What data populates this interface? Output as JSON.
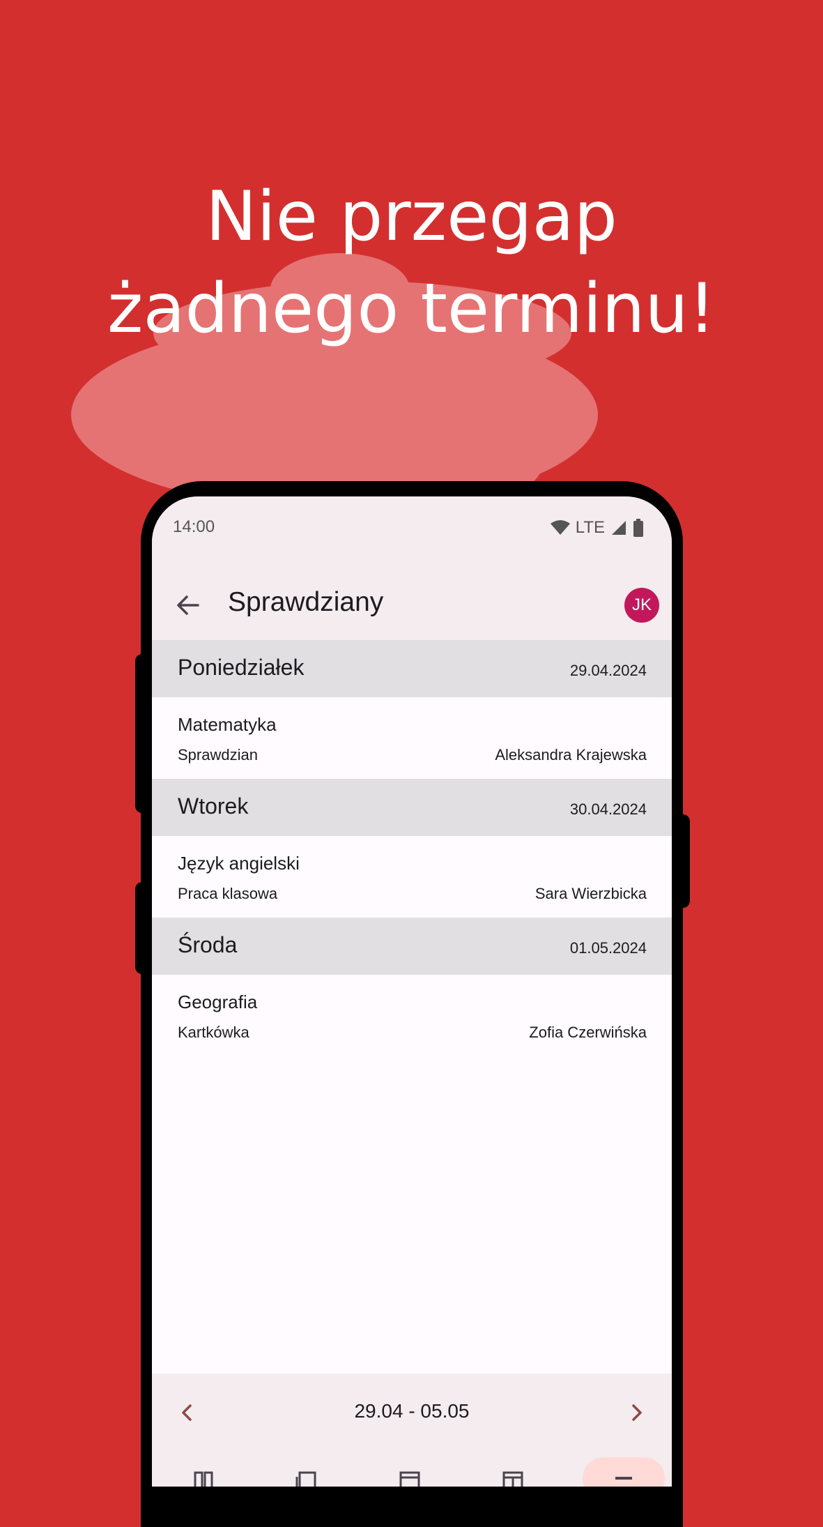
{
  "headline": {
    "line1": "Nie przegap",
    "line2": "żadnego terminu!"
  },
  "colors": {
    "background": "#d32f2f",
    "cloud": "#e57373",
    "surface": "#fffbfe",
    "app_bar": "#f4ecee",
    "day_header": "#e1dfe2",
    "avatar": "#c2185b",
    "accent": "#8c4a44"
  },
  "status_bar": {
    "time": "14:00",
    "network": "LTE",
    "icons": [
      "wifi-icon",
      "cell-signal-icon",
      "battery-icon"
    ]
  },
  "app_bar": {
    "title": "Sprawdziany",
    "avatar_initials": "JK",
    "back_icon": "arrow-back-icon"
  },
  "days": [
    {
      "name": "Poniedziałek",
      "date": "29.04.2024",
      "exams": [
        {
          "subject": "Matematyka",
          "type": "Sprawdzian",
          "teacher": "Aleksandra Krajewska"
        }
      ]
    },
    {
      "name": "Wtorek",
      "date": "30.04.2024",
      "exams": [
        {
          "subject": "Język angielski",
          "type": "Praca klasowa",
          "teacher": "Sara Wierzbicka"
        }
      ]
    },
    {
      "name": "Środa",
      "date": "01.05.2024",
      "exams": [
        {
          "subject": "Geografia",
          "type": "Kartkówka",
          "teacher": "Zofia Czerwińska"
        }
      ]
    }
  ],
  "week_nav": {
    "range": "29.04 - 05.05",
    "prev_icon": "chevron-left-icon",
    "next_icon": "chevron-right-icon"
  },
  "bottom_nav": {
    "icons": [
      "dashboard-icon",
      "grades-icon",
      "attendance-icon",
      "timetable-icon",
      "more-icon"
    ],
    "selected_index": 4
  }
}
